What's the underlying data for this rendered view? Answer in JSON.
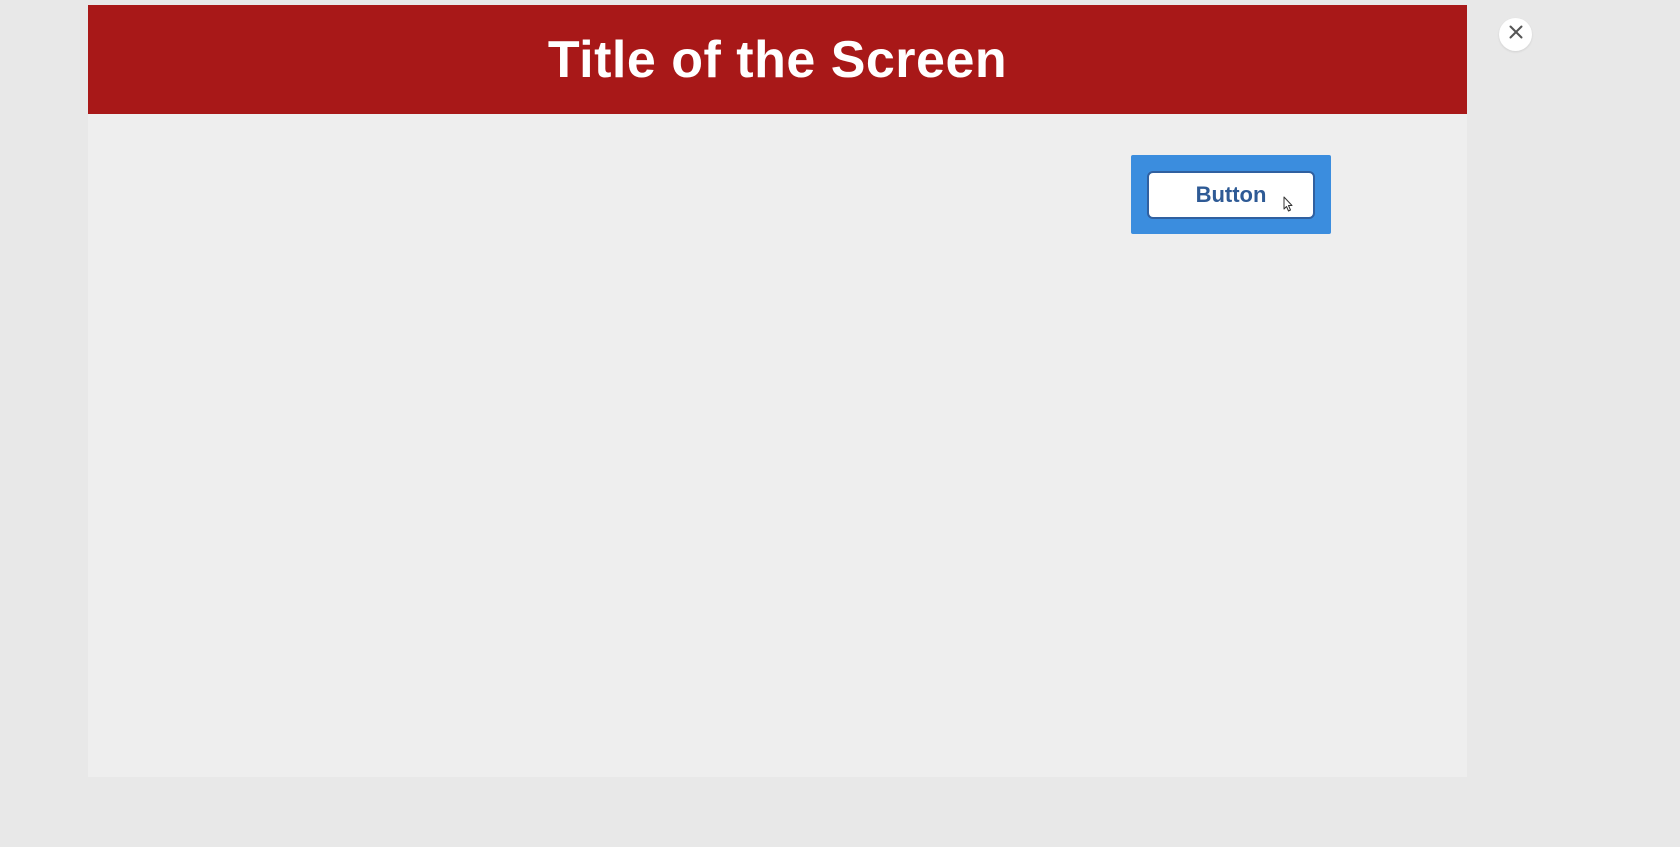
{
  "header": {
    "title": "Title of the Screen"
  },
  "content": {
    "button_label": "Button"
  },
  "colors": {
    "header_bg": "#a81818",
    "highlight": "#3b8dde",
    "button_border": "#3060a0",
    "button_text": "#2e5a95",
    "page_bg": "#e8e8e8",
    "panel_bg": "#eeeeee"
  }
}
